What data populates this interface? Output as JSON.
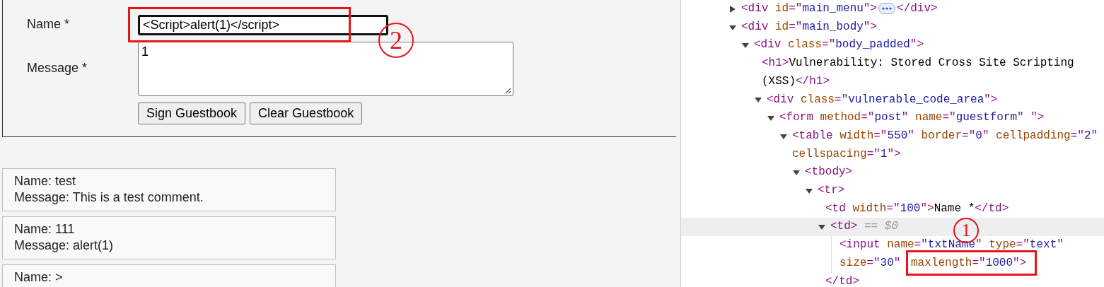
{
  "guestbook_form": {
    "name_label": "Name *",
    "name_value": "<Script>alert(1)</script>",
    "name_focused": true,
    "name_callout": "2",
    "message_label": "Message *",
    "message_value": "1",
    "buttons": [
      "Sign Guestbook",
      "Clear Guestbook"
    ]
  },
  "entries": [
    {
      "lines": [
        "Name: test",
        "Message: This is a test comment."
      ]
    },
    {
      "lines": [
        "Name: 111",
        "Message: alert(1)"
      ]
    },
    {
      "lines": [
        "Name: >"
      ]
    }
  ],
  "elements_tree": [
    {
      "expanded": false,
      "selected": false,
      "lines": [
        [
          {
            "kind": "tag",
            "text": "<div "
          },
          {
            "kind": "attr",
            "text": "id"
          },
          {
            "kind": "tag",
            "text": "=\""
          },
          {
            "kind": "value",
            "text": "main_menu"
          },
          {
            "kind": "tag",
            "text": "\">"
          }
        ]
      ],
      "closing": [
        {
          "kind": "tag",
          "text": "</div>"
        }
      ]
    },
    {
      "expanded": true,
      "selected": false,
      "lines": [
        [
          {
            "kind": "tag",
            "text": "<div "
          },
          {
            "kind": "attr",
            "text": "id"
          },
          {
            "kind": "tag",
            "text": "=\""
          },
          {
            "kind": "value",
            "text": "main_body"
          },
          {
            "kind": "tag",
            "text": "\">"
          }
        ]
      ],
      "children": [
        {
          "expanded": true,
          "selected": false,
          "lines": [
            [
              {
                "kind": "tag",
                "text": "<div "
              },
              {
                "kind": "attr",
                "text": "class"
              },
              {
                "kind": "tag",
                "text": "=\""
              },
              {
                "kind": "value",
                "text": "body_padded"
              },
              {
                "kind": "tag",
                "text": "\">"
              }
            ]
          ],
          "children": [
            {
              "selected": false,
              "lines": [
                [
                  {
                    "kind": "tag",
                    "text": "<h1>"
                  },
                  {
                    "kind": "text",
                    "text": "Vulnerability: Stored Cross Site Scripting"
                  }
                ],
                [
                  {
                    "kind": "text",
                    "text": "(XSS)"
                  },
                  {
                    "kind": "tag",
                    "text": "</h1>"
                  }
                ]
              ]
            },
            {
              "expanded": true,
              "selected": false,
              "lines": [
                [
                  {
                    "kind": "tag",
                    "text": "<div "
                  },
                  {
                    "kind": "attr",
                    "text": "class"
                  },
                  {
                    "kind": "tag",
                    "text": "=\""
                  },
                  {
                    "kind": "value",
                    "text": "vulnerable_code_area"
                  },
                  {
                    "kind": "tag",
                    "text": "\">"
                  }
                ]
              ],
              "children": [
                {
                  "expanded": true,
                  "selected": false,
                  "lines": [
                    [
                      {
                        "kind": "tag",
                        "text": "<form "
                      },
                      {
                        "kind": "attr",
                        "text": "method"
                      },
                      {
                        "kind": "tag",
                        "text": "=\""
                      },
                      {
                        "kind": "value",
                        "text": "post"
                      },
                      {
                        "kind": "tag",
                        "text": "\" "
                      },
                      {
                        "kind": "attr",
                        "text": "name"
                      },
                      {
                        "kind": "tag",
                        "text": "=\""
                      },
                      {
                        "kind": "value",
                        "text": "guestform"
                      },
                      {
                        "kind": "tag",
                        "text": "\" \">"
                      }
                    ]
                  ],
                  "children": [
                    {
                      "expanded": true,
                      "selected": false,
                      "lines": [
                        [
                          {
                            "kind": "tag",
                            "text": "<table "
                          },
                          {
                            "kind": "attr",
                            "text": "width"
                          },
                          {
                            "kind": "tag",
                            "text": "=\""
                          },
                          {
                            "kind": "value",
                            "text": "550"
                          },
                          {
                            "kind": "tag",
                            "text": "\" "
                          },
                          {
                            "kind": "attr",
                            "text": "border"
                          },
                          {
                            "kind": "tag",
                            "text": "=\""
                          },
                          {
                            "kind": "value",
                            "text": "0"
                          },
                          {
                            "kind": "tag",
                            "text": "\" "
                          },
                          {
                            "kind": "attr",
                            "text": "cellpadding"
                          },
                          {
                            "kind": "tag",
                            "text": "=\""
                          },
                          {
                            "kind": "value",
                            "text": "2"
                          },
                          {
                            "kind": "tag",
                            "text": "\""
                          }
                        ],
                        [
                          {
                            "kind": "attr",
                            "text": "cellspacing"
                          },
                          {
                            "kind": "tag",
                            "text": "=\""
                          },
                          {
                            "kind": "value",
                            "text": "1"
                          },
                          {
                            "kind": "tag",
                            "text": "\">"
                          }
                        ]
                      ],
                      "children": [
                        {
                          "expanded": true,
                          "selected": false,
                          "lines": [
                            [
                              {
                                "kind": "tag",
                                "text": "<tbody>"
                              }
                            ]
                          ],
                          "children": [
                            {
                              "expanded": true,
                              "selected": false,
                              "lines": [
                                [
                                  {
                                    "kind": "tag",
                                    "text": "<tr>"
                                  }
                                ]
                              ],
                              "children": [
                                {
                                  "selected": false,
                                  "lines": [
                                    [
                                      {
                                        "kind": "tag",
                                        "text": "<td "
                                      },
                                      {
                                        "kind": "attr",
                                        "text": "width"
                                      },
                                      {
                                        "kind": "tag",
                                        "text": "=\""
                                      },
                                      {
                                        "kind": "value",
                                        "text": "100"
                                      },
                                      {
                                        "kind": "tag",
                                        "text": "\">"
                                      },
                                      {
                                        "kind": "text",
                                        "text": "Name *"
                                      },
                                      {
                                        "kind": "tag",
                                        "text": "</td>"
                                      }
                                    ]
                                  ]
                                },
                                {
                                  "expanded": true,
                                  "selected": true,
                                  "lines": [
                                    [
                                      {
                                        "kind": "tag",
                                        "text": "<td>"
                                      },
                                      {
                                        "kind": "comment",
                                        "text": " == $0"
                                      }
                                    ]
                                  ],
                                  "children": [
                                    {
                                      "callout": "1",
                                      "selected": false,
                                      "lines": [
                                        [
                                          {
                                            "kind": "tag",
                                            "text": "<input "
                                          },
                                          {
                                            "kind": "attr",
                                            "text": "name"
                                          },
                                          {
                                            "kind": "tag",
                                            "text": "=\""
                                          },
                                          {
                                            "kind": "value",
                                            "text": "txtName"
                                          },
                                          {
                                            "kind": "tag",
                                            "text": "\" "
                                          },
                                          {
                                            "kind": "attr",
                                            "text": "type"
                                          },
                                          {
                                            "kind": "tag",
                                            "text": "=\""
                                          },
                                          {
                                            "kind": "value",
                                            "text": "text"
                                          },
                                          {
                                            "kind": "tag",
                                            "text": "\""
                                          }
                                        ],
                                        [
                                          {
                                            "kind": "attr",
                                            "text": "size"
                                          },
                                          {
                                            "kind": "tag",
                                            "text": "=\""
                                          },
                                          {
                                            "kind": "value",
                                            "text": "30"
                                          },
                                          {
                                            "kind": "tag",
                                            "text": "\" "
                                          },
                                          {
                                            "kind": "attr",
                                            "text": "maxlength",
                                            "boxed": true
                                          },
                                          {
                                            "kind": "tag",
                                            "text": "=\"",
                                            "boxed": true
                                          },
                                          {
                                            "kind": "value",
                                            "text": "1000",
                                            "boxed": true
                                          },
                                          {
                                            "kind": "tag",
                                            "text": "\">",
                                            "boxed": true
                                          }
                                        ]
                                      ]
                                    }
                                  ],
                                  "closing": [
                                    {
                                      "kind": "tag",
                                      "text": "</td>"
                                    }
                                  ]
                                }
                              ]
                            }
                          ]
                        }
                      ]
                    }
                  ]
                }
              ]
            }
          ]
        }
      ]
    }
  ]
}
